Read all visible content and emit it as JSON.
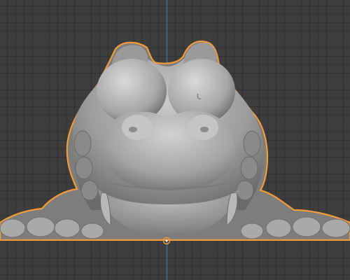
{
  "viewport": {
    "background": "#3d3d3d",
    "grid_color": "#484848",
    "z_axis_color": "#4f77b8",
    "selection_outline_color": "#f29b38"
  },
  "object": {
    "type": "sculpted mesh",
    "selected": true,
    "shading": "solid-matcap-gray"
  },
  "origin": {
    "icon": "object-origin-icon"
  }
}
